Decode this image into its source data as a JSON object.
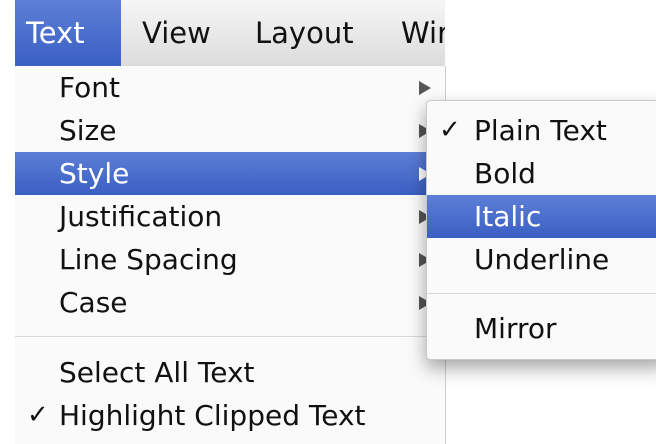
{
  "menubar": {
    "items": [
      {
        "label": "Text"
      },
      {
        "label": "View"
      },
      {
        "label": "Layout"
      },
      {
        "label": "Wir"
      }
    ]
  },
  "text_menu": {
    "items": [
      {
        "label": "Font"
      },
      {
        "label": "Size"
      },
      {
        "label": "Style"
      },
      {
        "label": "Justification"
      },
      {
        "label": "Line Spacing"
      },
      {
        "label": "Case"
      },
      {
        "label": "Select All Text"
      },
      {
        "label": "Highlight Clipped Text",
        "check": "✓"
      }
    ]
  },
  "style_submenu": {
    "items": [
      {
        "label": "Plain Text",
        "check": "✓"
      },
      {
        "label": "Bold"
      },
      {
        "label": "Italic"
      },
      {
        "label": "Underline"
      },
      {
        "label": "Mirror"
      }
    ]
  },
  "colors": {
    "highlight": "#3a5fc3",
    "menu_background": "#fafafa"
  }
}
